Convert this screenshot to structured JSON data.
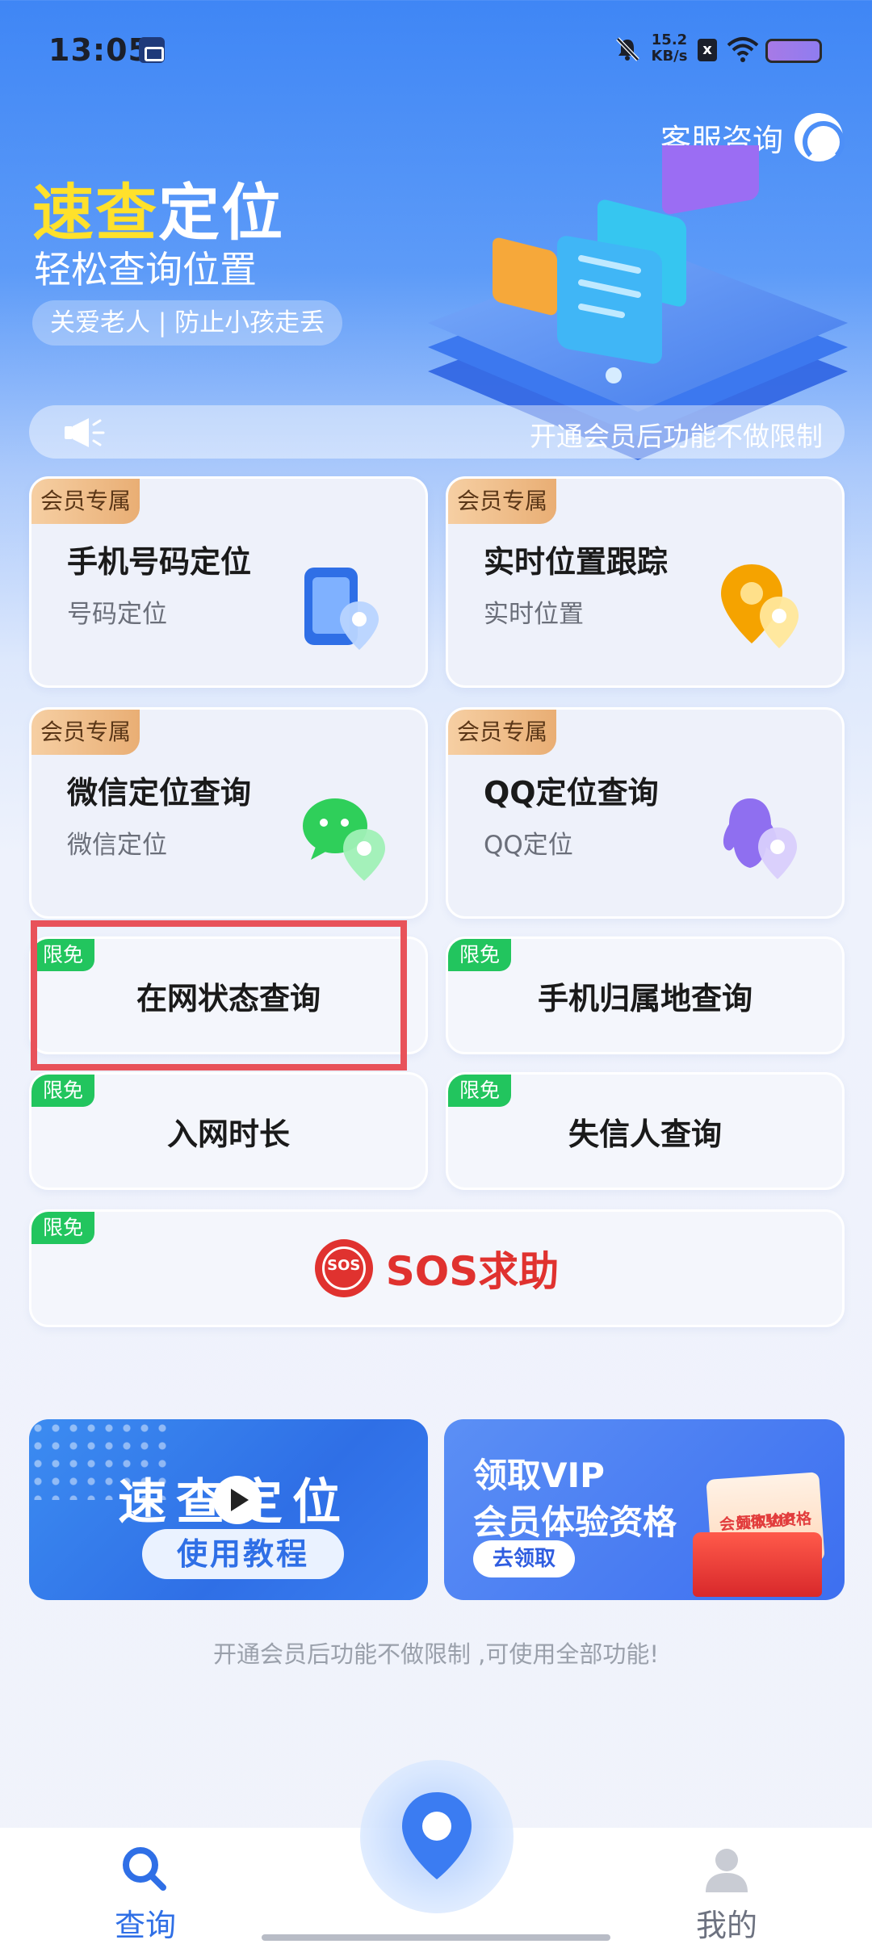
{
  "status_bar": {
    "time": "13:05",
    "net_speed_value": "15.2",
    "net_speed_unit": "KB/s",
    "x_badge": "x",
    "icons": [
      "app-notification-icon",
      "mute-icon",
      "x-badge-icon",
      "wifi-icon",
      "battery-icon"
    ]
  },
  "header": {
    "support_label": "客服咨询",
    "title_highlight": "速查",
    "title_rest": "定位",
    "subtitle": "轻松查询位置",
    "slogan": "关爱老人 | 防止小孩走丢"
  },
  "notice": {
    "text": "开通会员后功能不做限制"
  },
  "vip_cards": [
    {
      "tag": "会员专属",
      "title": "手机号码定位",
      "subtitle": "号码定位",
      "icon": "phone-location-icon"
    },
    {
      "tag": "会员专属",
      "title": "实时位置跟踪",
      "subtitle": "实时位置",
      "icon": "map-pin-icon"
    },
    {
      "tag": "会员专属",
      "title": "微信定位查询",
      "subtitle": "微信定位",
      "icon": "wechat-icon"
    },
    {
      "tag": "会员专属",
      "title": "QQ定位查询",
      "subtitle": "QQ定位",
      "icon": "qq-icon"
    }
  ],
  "free_cards": [
    {
      "tag": "限免",
      "label": "在网状态查询"
    },
    {
      "tag": "限免",
      "label": "手机归属地查询"
    },
    {
      "tag": "限免",
      "label": "入网时长"
    },
    {
      "tag": "限免",
      "label": "失信人查询"
    }
  ],
  "sos_card": {
    "tag": "限免",
    "icon_text": "SOS",
    "label": "SOS求助"
  },
  "banners": {
    "tutorial": {
      "title": "速查定位",
      "button": "使用教程"
    },
    "vip": {
      "line1": "领取VIP",
      "line2": "会员体验资格",
      "button": "去领取",
      "card_line1": "领取VIP",
      "card_line2": "会员体验资格"
    }
  },
  "footer_note": "开通会员后功能不做限制 ,可使用全部功能!",
  "bottom_nav": {
    "search_label": "查询",
    "mine_label": "我的"
  },
  "colors": {
    "brand_blue": "#3f86f5",
    "title_yellow": "#ffe12b",
    "vip_tag": "#e9ae74",
    "free_tag": "#22c55e",
    "sos_red": "#e0322f",
    "highlight_red": "#e8525a"
  }
}
